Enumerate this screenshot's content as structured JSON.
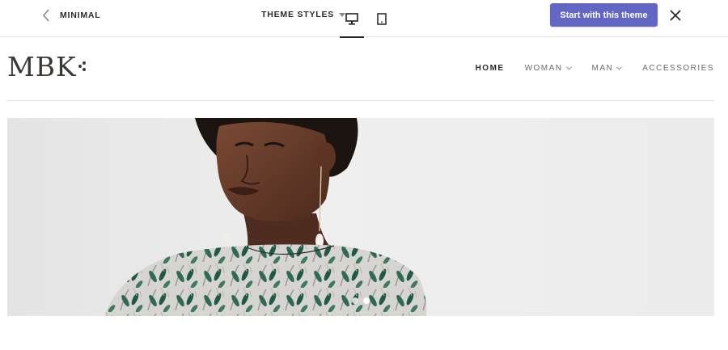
{
  "editor": {
    "back_label": "MINIMAL",
    "theme_styles_label": "THEME STYLES",
    "cta_label": "Start with this theme",
    "accent_color": "#6167c2",
    "icons": [
      "chevron-left-icon",
      "caret-down-icon",
      "desktop-icon",
      "tablet-icon",
      "close-icon"
    ]
  },
  "site": {
    "logo": "MBK",
    "nav": [
      {
        "label": "HOME",
        "active": true
      },
      {
        "label": "WOMAN",
        "has_dropdown": true
      },
      {
        "label": "MAN",
        "has_dropdown": true
      },
      {
        "label": "ACCESSORIES"
      }
    ]
  },
  "hero": {
    "slides": 2,
    "active_slide": 2
  }
}
